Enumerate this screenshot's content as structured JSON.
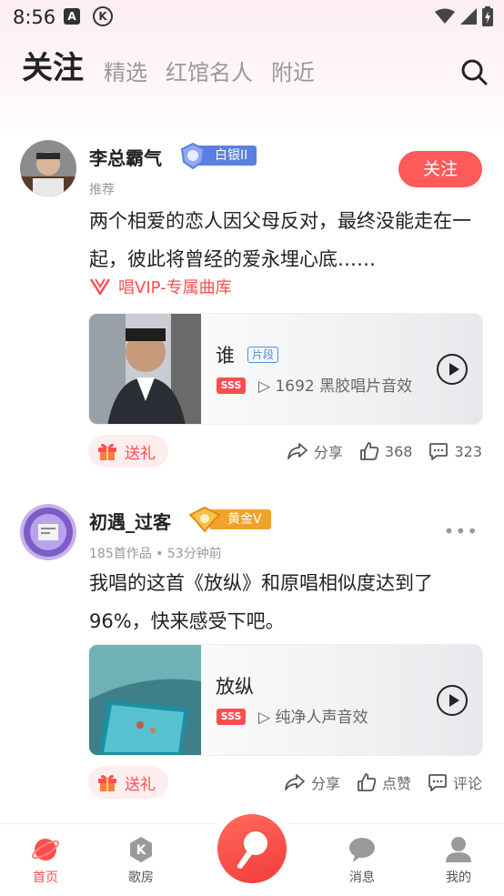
{
  "status_bar": {
    "time": "8:56",
    "a_label": "A",
    "k_label": "K"
  },
  "header": {
    "tabs": [
      {
        "label": "关注"
      },
      {
        "label": "精选"
      },
      {
        "label": "红馆名人"
      },
      {
        "label": "附近"
      }
    ]
  },
  "posts": [
    {
      "username": "李总霸气",
      "badge": "白银II",
      "meta": "推荐",
      "text": "两个相爱的恋人因父母反对，最终没能走在一起，彼此将曾经的爱永埋心底……",
      "follow_label": "关注",
      "vip_text": "唱VIP-专属曲库",
      "song": {
        "title": "谁",
        "tag": "片段",
        "quality": "SSS",
        "play_info": "1692 黑胶唱片音效"
      },
      "gift_label": "送礼",
      "actions": {
        "share": "分享",
        "likes": "368",
        "comments": "323"
      }
    },
    {
      "username": "初遇_过客",
      "badge": "黄金V",
      "meta": "185首作品 • 53分钟前",
      "more": "•••",
      "text": "我唱的这首《放纵》和原唱相似度达到了96%，快来感受下吧。",
      "song": {
        "title": "放纵",
        "quality": "SSS",
        "play_info": "纯净人声音效"
      },
      "gift_label": "送礼",
      "actions": {
        "share": "分享",
        "likes": "点赞",
        "comments": "评论"
      }
    }
  ],
  "bottom_nav": {
    "items": [
      {
        "label": "首页"
      },
      {
        "label": "歌房"
      },
      {
        "label": "消息"
      },
      {
        "label": "我的"
      }
    ]
  },
  "colors": {
    "accent": "#ff4d4f",
    "silver_badge": "#5b7fe0",
    "gold_badge": "#f2a12b"
  }
}
